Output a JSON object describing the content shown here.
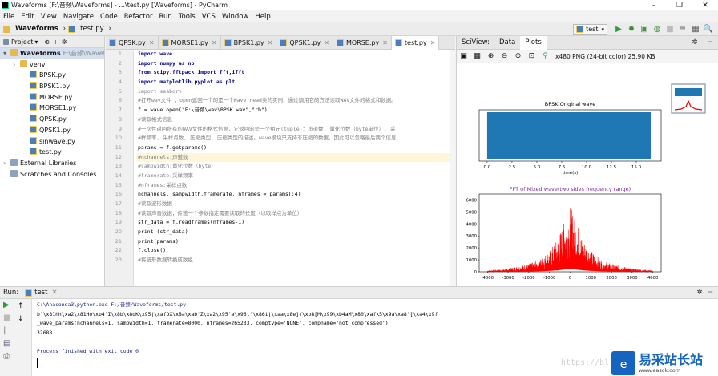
{
  "window": {
    "title": "Waveforms [F:\\音频\\Waveforms] - ...\\test.py [Waveforms] - PyCharm",
    "controls": [
      "–",
      "❐",
      "✕"
    ]
  },
  "menu": [
    "File",
    "Edit",
    "View",
    "Navigate",
    "Code",
    "Refactor",
    "Run",
    "Tools",
    "VCS",
    "Window",
    "Help"
  ],
  "nav": {
    "project": "Waveforms",
    "file": "test.py",
    "run_config": "test",
    "search": "🔍"
  },
  "project_panel": {
    "header": "Project",
    "tree": [
      {
        "label": "Waveforms",
        "hint": "F:\\音频\\Waveforms",
        "kind": "fold",
        "indent": 0,
        "arrow": "▾"
      },
      {
        "label": "venv",
        "kind": "fold",
        "indent": 1,
        "arrow": "›"
      },
      {
        "label": "BPSK.py",
        "kind": "py",
        "indent": 2,
        "arrow": ""
      },
      {
        "label": "BPSK1.py",
        "kind": "py",
        "indent": 2,
        "arrow": ""
      },
      {
        "label": "MORSE.py",
        "kind": "py",
        "indent": 2,
        "arrow": ""
      },
      {
        "label": "MORSE1.py",
        "kind": "py",
        "indent": 2,
        "arrow": ""
      },
      {
        "label": "QPSK.py",
        "kind": "py",
        "indent": 2,
        "arrow": ""
      },
      {
        "label": "QPSK1.py",
        "kind": "py",
        "indent": 2,
        "arrow": ""
      },
      {
        "label": "sinwave.py",
        "kind": "py",
        "indent": 2,
        "arrow": ""
      },
      {
        "label": "test.py",
        "kind": "py",
        "indent": 2,
        "arrow": ""
      },
      {
        "label": "External Libraries",
        "kind": "lib",
        "indent": 0,
        "arrow": "›"
      },
      {
        "label": "Scratches and Consoles",
        "kind": "lib",
        "indent": 0,
        "arrow": ""
      }
    ]
  },
  "tabs": [
    {
      "label": "QPSK.py",
      "active": false
    },
    {
      "label": "MORSE1.py",
      "active": false
    },
    {
      "label": "BPSK1.py",
      "active": false
    },
    {
      "label": "QPSK1.py",
      "active": false
    },
    {
      "label": "MORSE.py",
      "active": false
    },
    {
      "label": "test.py",
      "active": true
    }
  ],
  "code": [
    {
      "n": "1",
      "t": "import wave",
      "c": "kw"
    },
    {
      "n": "2",
      "t": "import numpy as np",
      "c": "kw"
    },
    {
      "n": "3",
      "t": "from scipy.fftpack import fft,ifft",
      "c": "kw"
    },
    {
      "n": "4",
      "t": "import matplotlib.pyplot as plt",
      "c": "kw"
    },
    {
      "n": "5",
      "t": "import seaborn",
      "c": "cm"
    },
    {
      "n": "6",
      "t": "#打开wav文件 ，open返回一个的是一个Wave_read类的实例，通过调用它的方法读取WAV文件的格式和数据。",
      "c": "cm"
    },
    {
      "n": "7",
      "t": "f = wave.open(\"F:\\音频\\wav\\BPSK.wav\",\"rb\")",
      "c": "bl"
    },
    {
      "n": "8",
      "t": "#读取格式信息",
      "c": "cm"
    },
    {
      "n": "9",
      "t": "#一次性返回所有的WAV文件的格式信息，它返回的是一个组元(tuple)：声道数, 量化位数（byte单位）, 采",
      "c": "cm"
    },
    {
      "n": "10",
      "t": "#样频率, 采样点数, 压缩类型, 压缩类型的描述。wave模块只支持非压缩的数据，因此可以忽略最后两个信息",
      "c": "cm"
    },
    {
      "n": "11",
      "t": "params = f.getparams()",
      "c": "bl"
    },
    {
      "n": "12",
      "t": "#nchannels:声道数",
      "c": "cm hl"
    },
    {
      "n": "13",
      "t": "#sampwidth:量化位数（byte）",
      "c": "cm"
    },
    {
      "n": "14",
      "t": "#framerate:采样频率",
      "c": "cm"
    },
    {
      "n": "15",
      "t": "#nframes:采样点数",
      "c": "cm"
    },
    {
      "n": "16",
      "t": "nchannels, sampwidth,framerate, nframes = params[:4]",
      "c": "bl"
    },
    {
      "n": "17",
      "t": "#读取波形数据",
      "c": "cm"
    },
    {
      "n": "18",
      "t": "#读取声音数据，传递一个参数指定需要读取的长度（以取样点为单位）",
      "c": "cm"
    },
    {
      "n": "19",
      "t": "str_data  = f.readframes(nframes-1)",
      "c": "bl"
    },
    {
      "n": "20",
      "t": "print (str_data)",
      "c": "bl"
    },
    {
      "n": "21",
      "t": "print(params)",
      "c": "bl"
    },
    {
      "n": "22",
      "t": "f.close()",
      "c": "bl"
    },
    {
      "n": "23",
      "t": "#将波形数据转换成数组",
      "c": "cm"
    }
  ],
  "sciview": {
    "tabs": [
      "SciView:",
      "Data",
      "Plots"
    ],
    "image_info": "x480 PNG (24-bit color) 25.90 KB"
  },
  "chart_data": [
    {
      "type": "area",
      "title": "BPSK Original wave",
      "xlabel": "time(s)",
      "ylabel": "",
      "x": [
        0,
        2.5,
        5,
        7.5,
        10,
        12.5,
        15,
        16.5
      ],
      "y": [
        1,
        1,
        1,
        1,
        1,
        1,
        1,
        1
      ],
      "xticks": [
        "0.0",
        "2.5",
        "5.0",
        "7.5",
        "10.0",
        "12.5",
        "15.0"
      ],
      "xlim": [
        -0.8,
        17.5
      ]
    },
    {
      "type": "line",
      "title": "FFT of Mixed wave(two sides frequency range)",
      "xlabel": "",
      "ylabel": "",
      "x": [
        -4000,
        -3000,
        -2000,
        -1500,
        -1000,
        -600,
        -300,
        0,
        300,
        600,
        1000,
        1500,
        2000,
        3000,
        4000
      ],
      "y": [
        100,
        250,
        600,
        900,
        1600,
        2500,
        3800,
        5000,
        3800,
        2500,
        1600,
        900,
        600,
        250,
        100
      ],
      "xticks": [
        "-4000",
        "-3000",
        "-2000",
        "-1000",
        "0",
        "1000",
        "2000",
        "3000",
        "4000"
      ],
      "yticks": [
        "0",
        "1000",
        "2000",
        "3000",
        "4000",
        "5000",
        "6000"
      ],
      "xlim": [
        -4400,
        4400
      ],
      "ylim": [
        0,
        6500
      ],
      "color": "#ff0000"
    }
  ],
  "run": {
    "label": "Run:",
    "config": "test"
  },
  "console": [
    {
      "t": "C:\\Anaconda3\\python.exe F:/音频/Waveforms/test.py",
      "c": "#1a237e"
    },
    {
      "t": "b'\\x81hh\\xa2\\x81Ho\\xb4'I\\x8b\\x8dK\\x95|\\xafDX\\x8a\\xab'Z\\xa2\\x95'a\\x96t'\\x86ij\\xaa\\x8e]f\\xb8[M\\x99\\xb4aM\\x80\\xafk5\\x9a\\xa8'[\\xa4\\x9f",
      "c": "#000"
    },
    {
      "t": "_wave_params(nchannels=1, sampwidth=1, framerate=8000, nframes=265233, comptype='NONE', compname='not compressed')",
      "c": "#000"
    },
    {
      "t": "32688",
      "c": "#000"
    },
    {
      "t": "",
      "c": "#000"
    },
    {
      "t": "Process finished with exit code 0",
      "c": "#1a237e"
    }
  ],
  "watermark": {
    "url": "https://blog.",
    "brand": "易采站长站",
    "sub": "www.easck.com"
  }
}
